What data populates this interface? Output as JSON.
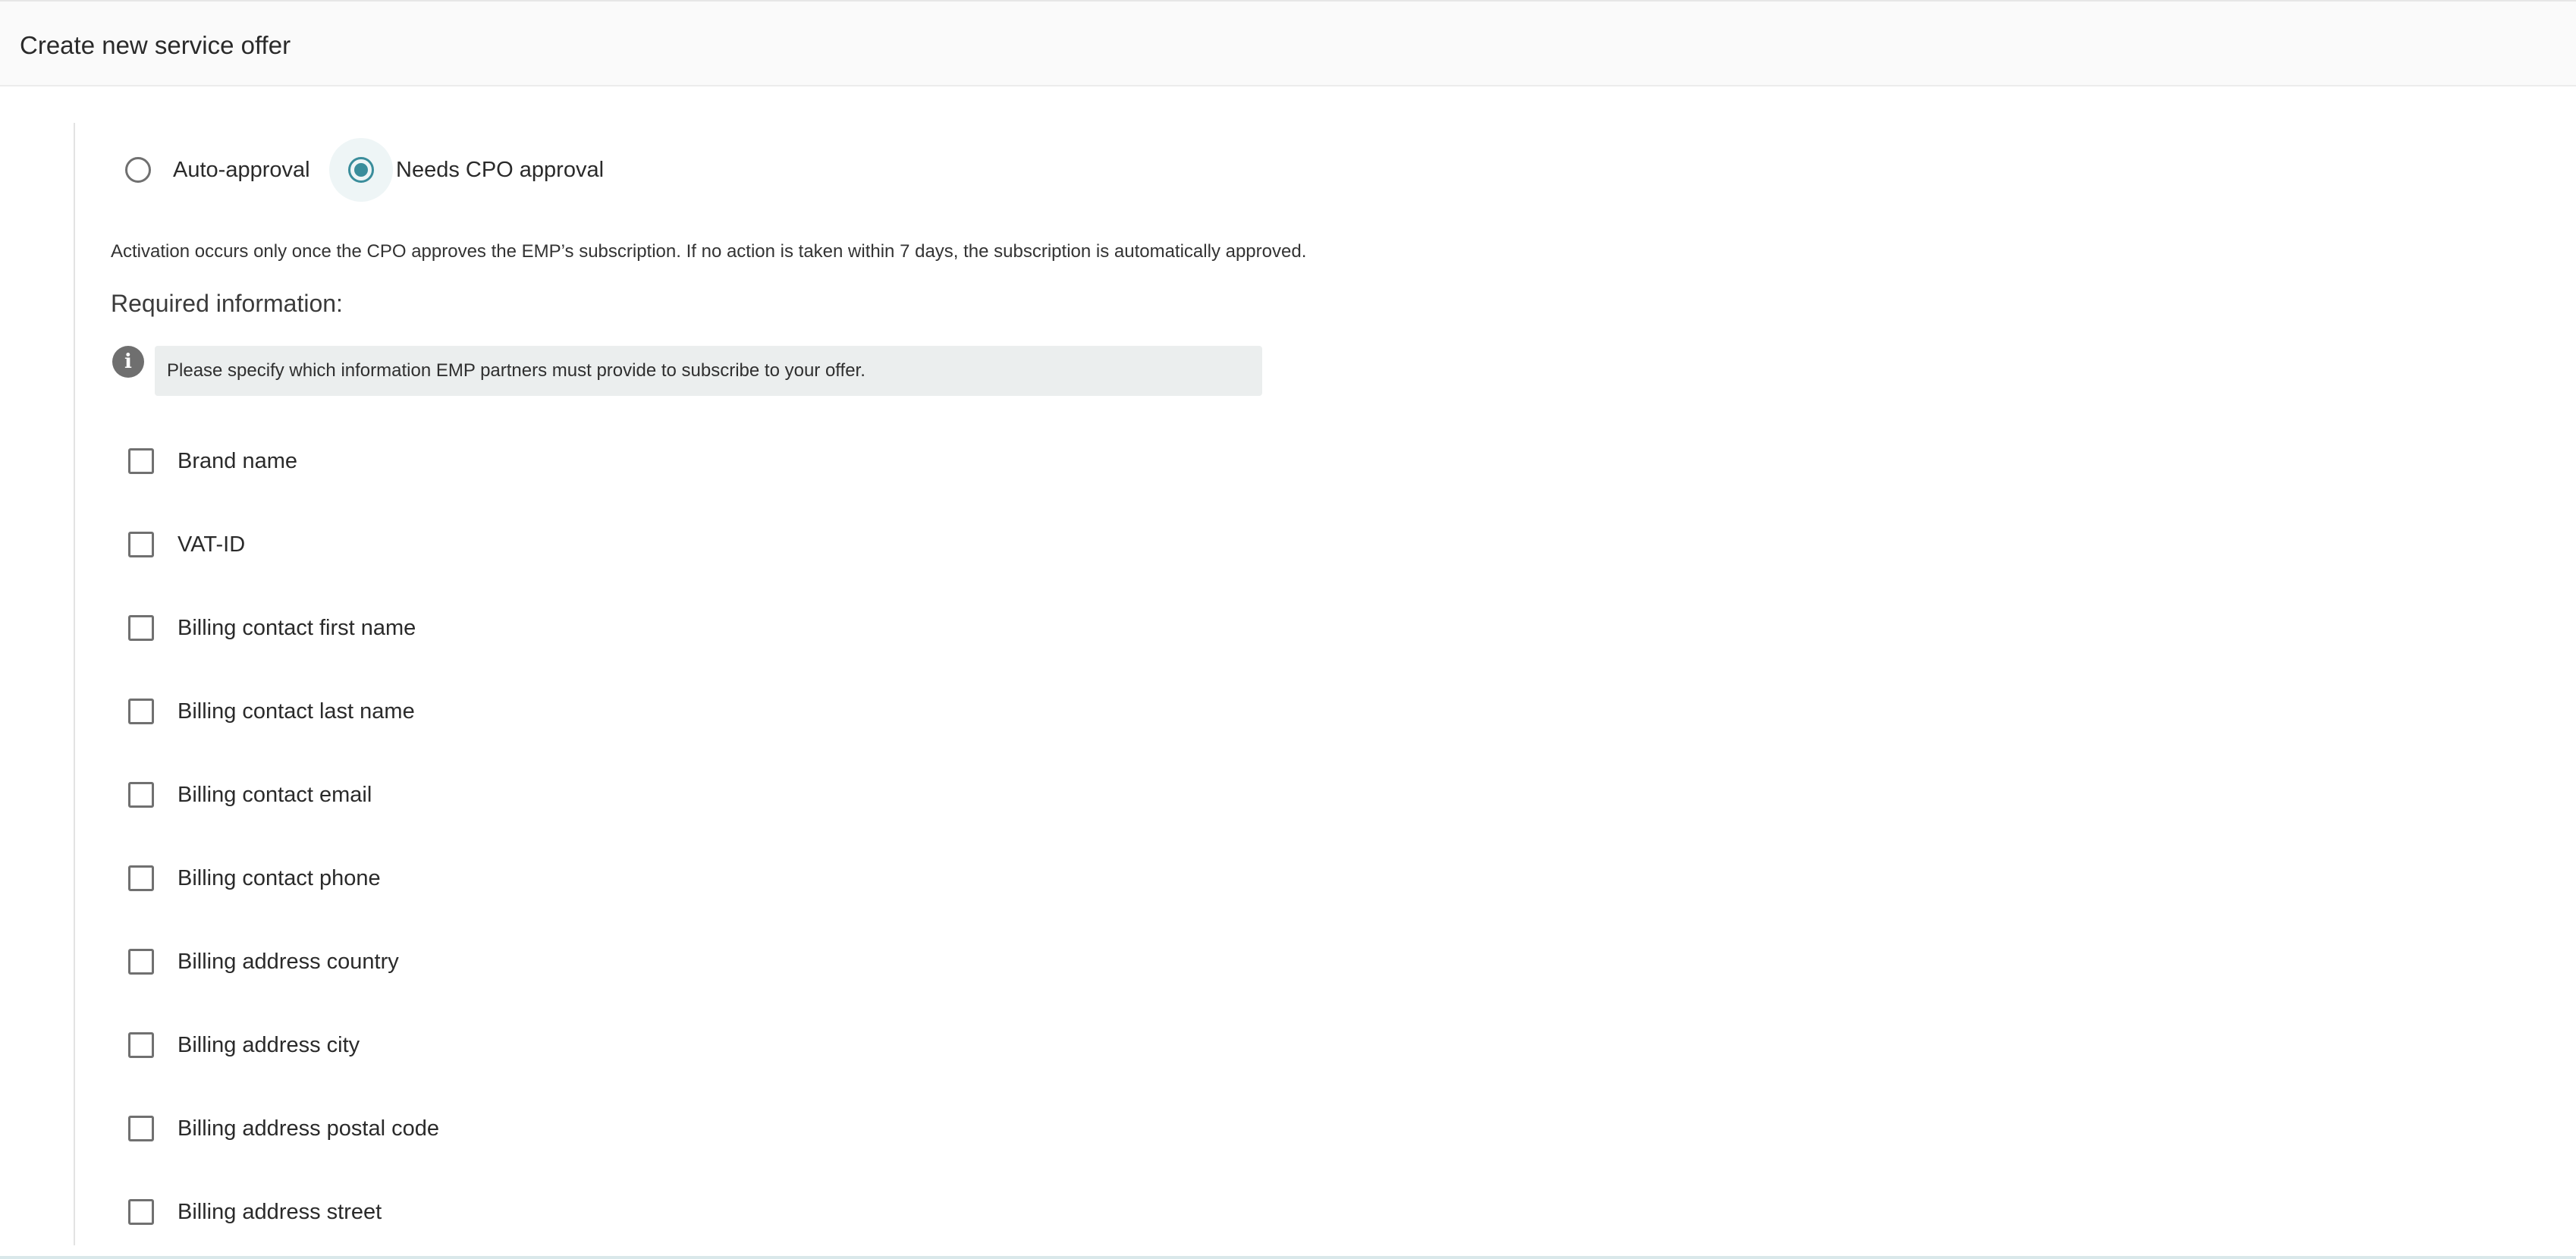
{
  "header": {
    "title": "Create new service offer"
  },
  "approval": {
    "options": [
      {
        "label": "Auto-approval",
        "selected": false
      },
      {
        "label": "Needs CPO approval",
        "selected": true
      }
    ],
    "description": "Activation occurs only once the CPO approves the EMP’s subscription. If no action is taken within 7 days, the subscription is automatically approved."
  },
  "required_info": {
    "title": "Required information:",
    "info_icon": "info-icon",
    "info_text": "Please specify which information EMP partners must provide to subscribe to your offer.",
    "fields": [
      {
        "label": "Brand name",
        "checked": false
      },
      {
        "label": "VAT-ID",
        "checked": false
      },
      {
        "label": "Billing contact first name",
        "checked": false
      },
      {
        "label": "Billing contact last name",
        "checked": false
      },
      {
        "label": "Billing contact email",
        "checked": false
      },
      {
        "label": "Billing contact phone",
        "checked": false
      },
      {
        "label": "Billing address country",
        "checked": false
      },
      {
        "label": "Billing address city",
        "checked": false
      },
      {
        "label": "Billing address postal code",
        "checked": false
      },
      {
        "label": "Billing address street",
        "checked": false
      }
    ]
  },
  "colors": {
    "accent": "#3a8d9b",
    "control_border": "#707070",
    "info_box_bg": "#ebeeee",
    "header_bg": "#fafafa"
  }
}
